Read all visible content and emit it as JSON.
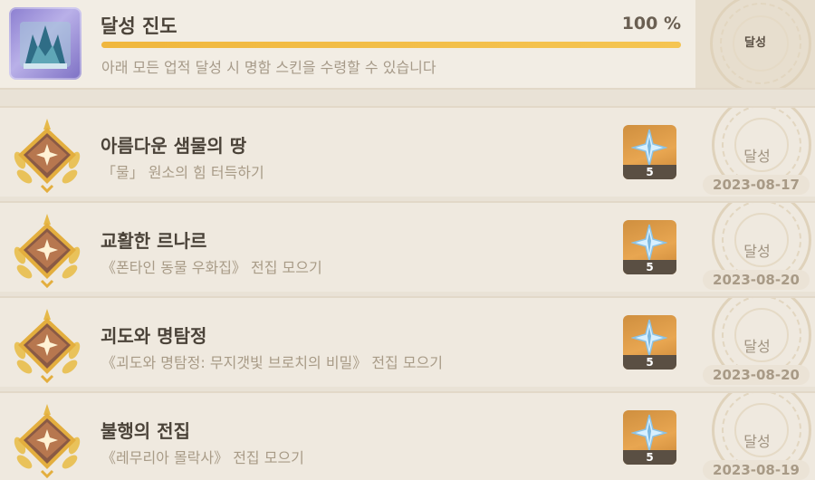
{
  "header": {
    "title": "달성 진도",
    "percent_label": "100 %",
    "progress": 1.0,
    "description": "아래 모든 업적 달성 시 명함 스킨을 수령할 수 있습니다",
    "status": "달성"
  },
  "achievements": [
    {
      "title": "아름다운 샘물의 땅",
      "description": "「물」 원소의 힘 터득하기",
      "reward_count": "5",
      "status": "달성",
      "date": "2023-08-17",
      "reward_icon": "primogem-icon"
    },
    {
      "title": "교활한 르나르",
      "description": "《폰타인 동물 우화집》 전집 모으기",
      "reward_count": "5",
      "status": "달성",
      "date": "2023-08-20",
      "reward_icon": "primogem-icon"
    },
    {
      "title": "괴도와 명탐정",
      "description": "《괴도와 명탐정: 무지갯빛 브로치의 비밀》 전집 모으기",
      "reward_count": "5",
      "status": "달성",
      "date": "2023-08-20",
      "reward_icon": "primogem-icon"
    },
    {
      "title": "불행의 전집",
      "description": "《레무리아 몰락사》 전집 모으기",
      "reward_count": "5",
      "status": "달성",
      "date": "2023-08-19",
      "reward_icon": "primogem-icon"
    }
  ],
  "colors": {
    "accent": "#f0b73e",
    "reward_bg": "#e8a651",
    "text": "#4b4339",
    "muted": "#a89b87"
  }
}
